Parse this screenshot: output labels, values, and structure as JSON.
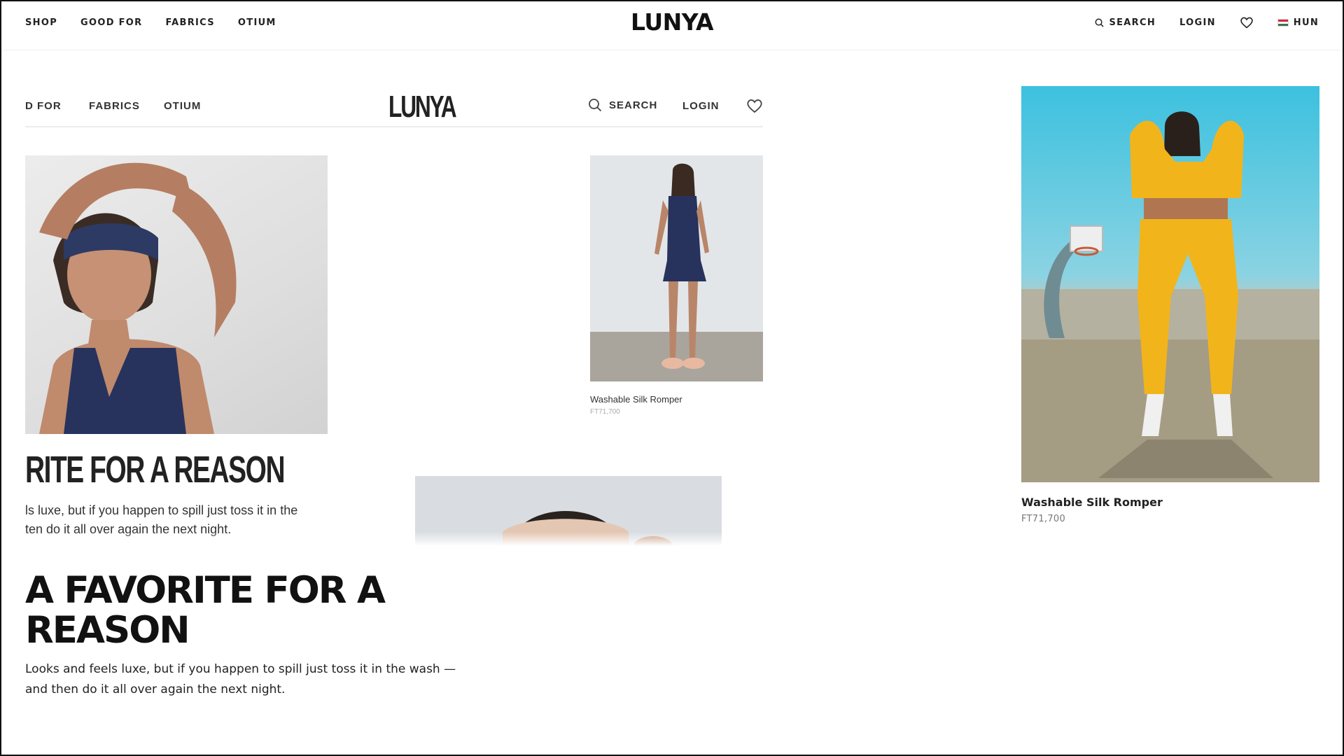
{
  "nav": {
    "left": [
      "SHOP",
      "GOOD FOR",
      "FABRICS",
      "OTIUM"
    ],
    "brand": "LUNYA",
    "search": "SEARCH",
    "login": "LOGIN",
    "region": "HUN"
  },
  "inset": {
    "nav": [
      "D FOR",
      "FABRICS",
      "OTIUM"
    ],
    "brand": "LUNYA",
    "search": "SEARCH",
    "login": "LOGIN",
    "product_name": "Washable Silk Romper",
    "product_price": "FT71,700",
    "heading": "RITE FOR A REASON",
    "body_line1": "ls luxe, but if you happen to spill just toss it in the",
    "body_line2": "ten do it all over again the next night."
  },
  "feature": {
    "heading": "A FAVORITE FOR A REASON",
    "body": "Looks and feels luxe, but if you happen to spill just toss it in the wash — and then do it all over again the next night."
  },
  "product": {
    "name": "Washable Silk Romper",
    "price": "FT71,700"
  },
  "icons": [
    "search-icon",
    "heart-icon",
    "flag-icon"
  ],
  "colors": {
    "sky": "#3cc1df",
    "sweatsuit": "#f2b41b",
    "navy_silk": "#27335c"
  }
}
